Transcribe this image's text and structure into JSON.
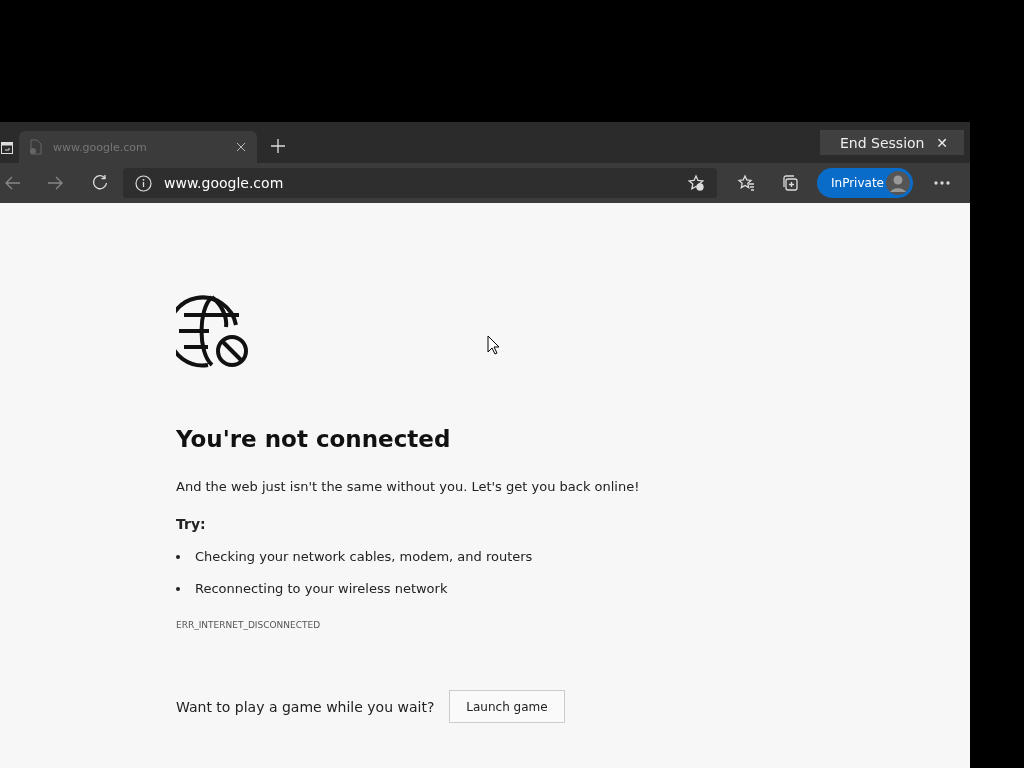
{
  "tabs": [
    {
      "title": "www.google.com",
      "selected": true
    }
  ],
  "end_session": {
    "label": "End Session",
    "close": "✕"
  },
  "address_bar": {
    "url": "www.google.com"
  },
  "inprivate": {
    "label": "InPrivate"
  },
  "error_page": {
    "heading": "You're not connected",
    "message": "And the web just isn't the same without you. Let's get you back online!",
    "try_label": "Try:",
    "suggestions": [
      "Checking your network cables, modem, and routers",
      "Reconnecting to your wireless network"
    ],
    "error_code": "ERR_INTERNET_DISCONNECTED",
    "game_prompt": "Want to play a game while you wait?",
    "game_button": "Launch game"
  }
}
